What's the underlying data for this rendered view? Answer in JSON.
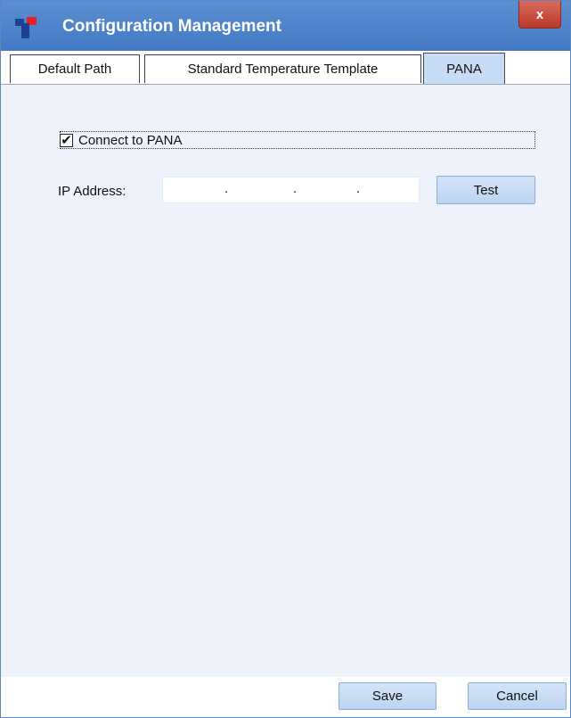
{
  "window": {
    "title": "Configuration Management",
    "close_label": "x"
  },
  "tabs": [
    {
      "label": "Default Path",
      "active": false
    },
    {
      "label": "Standard Temperature Template",
      "active": false
    },
    {
      "label": "PANA",
      "active": true
    }
  ],
  "pana": {
    "connect_label": "Connect to PANA",
    "connect_checked": true,
    "check_mark": "✔",
    "ip_label": "IP Address:",
    "ip_value": "",
    "ip_separator": ".",
    "test_label": "Test"
  },
  "footer": {
    "save_label": "Save",
    "cancel_label": "Cancel"
  },
  "colors": {
    "titlebar": "#4a82c9",
    "active_tab": "#c6dcf5",
    "content_bg": "#eef3fb",
    "button": "#c9ddf5",
    "close_button": "#c9493a"
  }
}
